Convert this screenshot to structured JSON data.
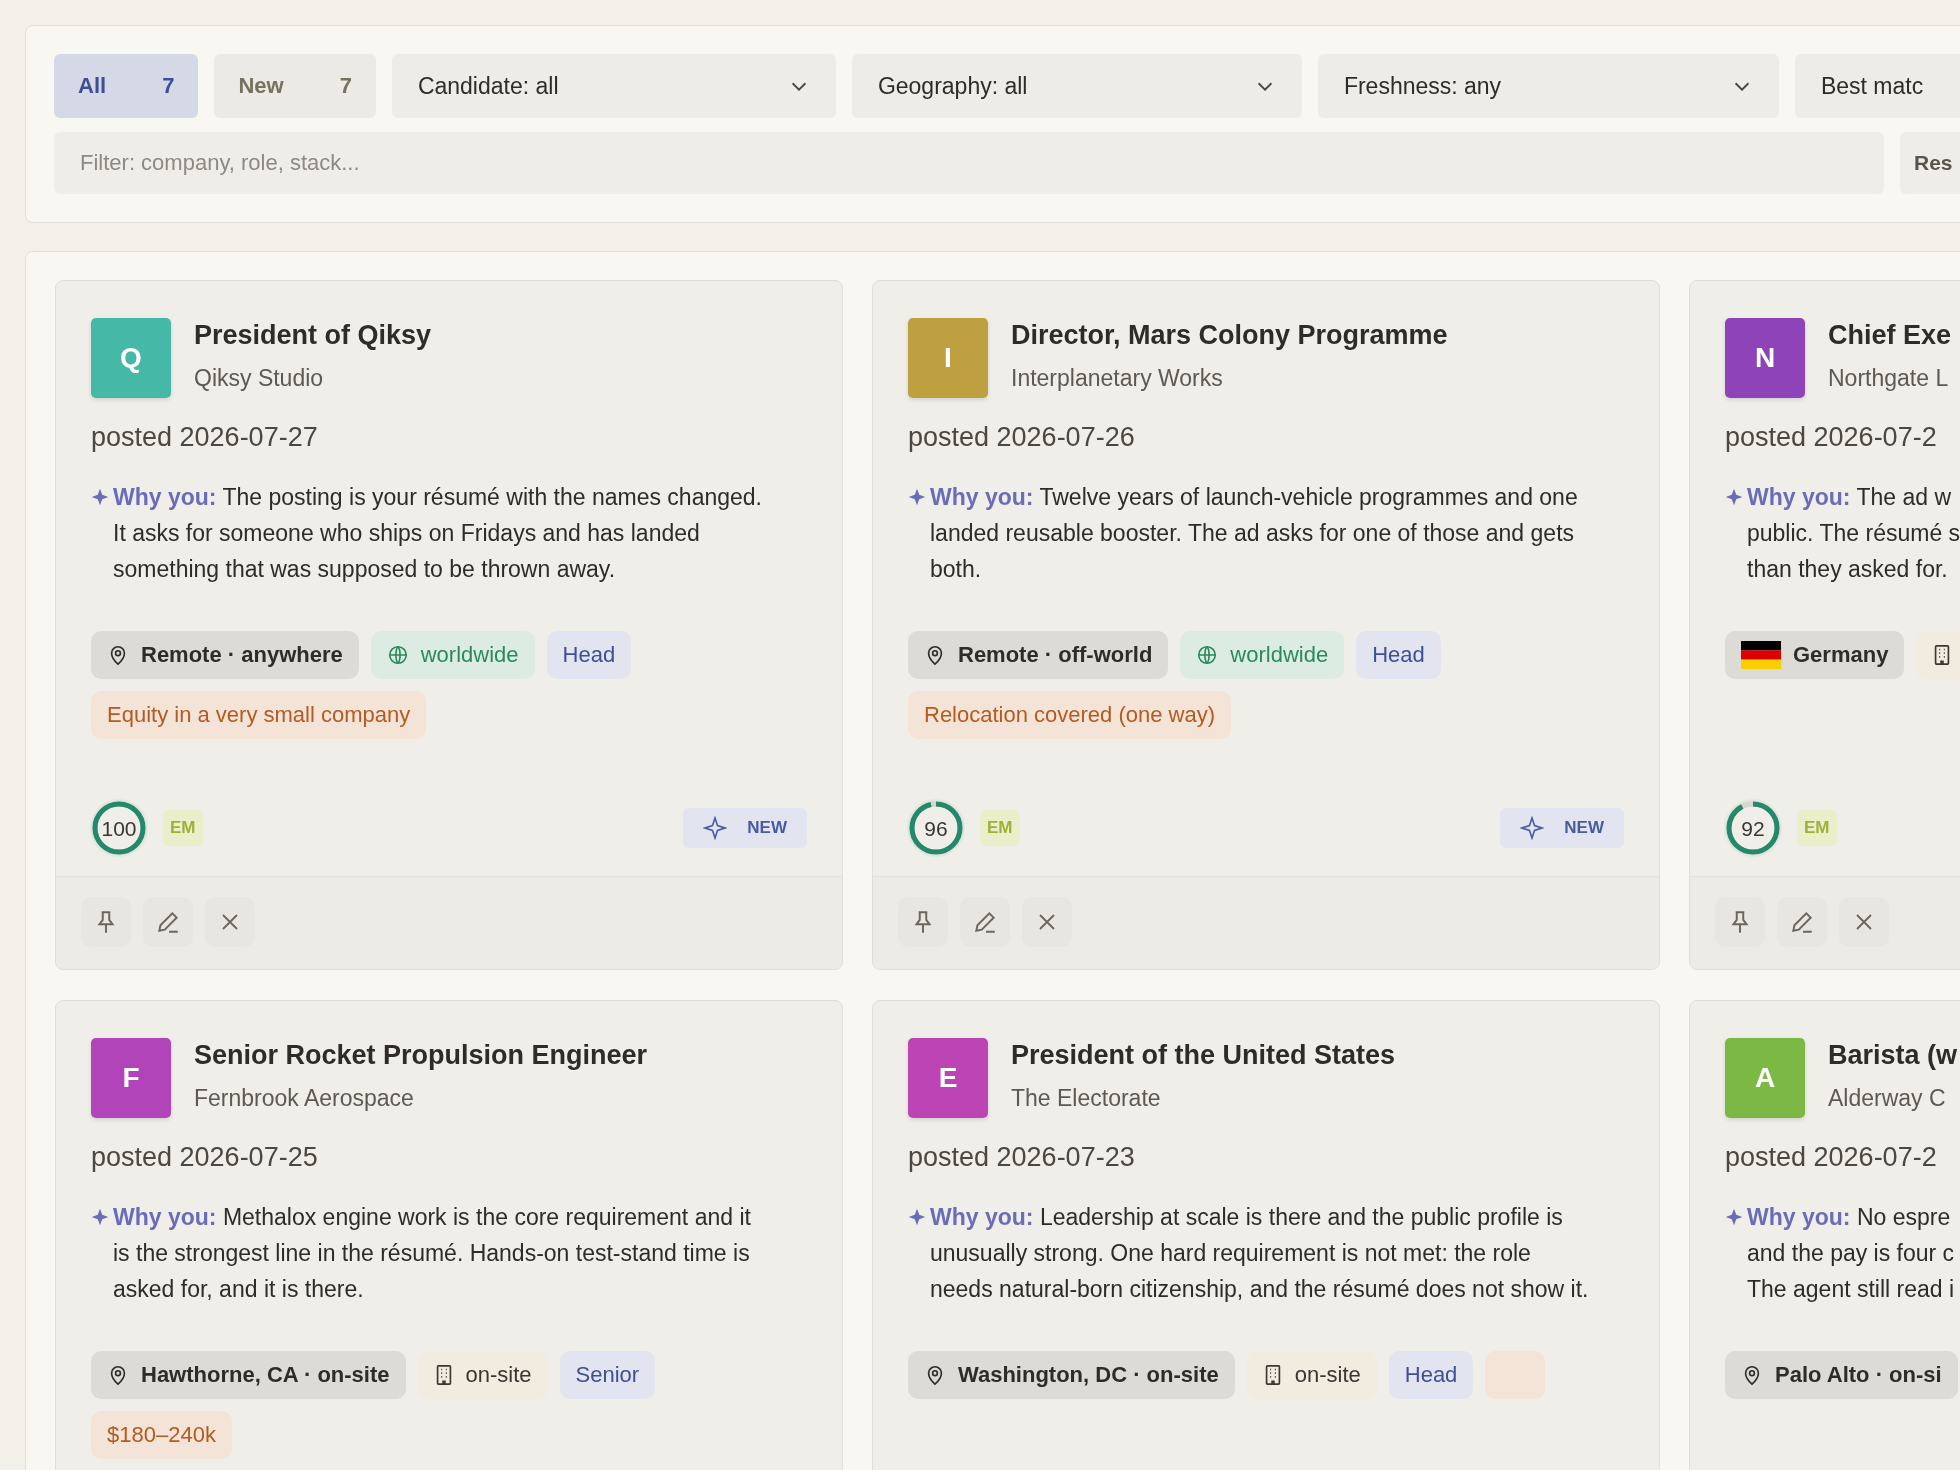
{
  "filters": {
    "tabs": [
      {
        "label": "All",
        "count": "7",
        "selected": true
      },
      {
        "label": "New",
        "count": "7",
        "selected": false
      }
    ],
    "dropdowns": [
      {
        "label": "Candidate: all"
      },
      {
        "label": "Geography: all"
      },
      {
        "label": "Freshness: any"
      },
      {
        "label": "Best matc"
      }
    ],
    "search": {
      "placeholder": "Filter: company, role, stack..."
    },
    "button": "Res"
  },
  "cards": [
    {
      "letter": "Q",
      "color": "#45b8a8",
      "title": "President of Qiksy",
      "company": "Qiksy Studio",
      "posted": "posted 2026-07-27",
      "why_label": "Why you:",
      "why": "The posting is your résumé with the names changed. It asks for someone who ships on Fridays and has landed something that was supposed to be thrown away.",
      "tags": [
        {
          "kind": "location",
          "label": "Remote · anywhere"
        },
        {
          "kind": "remote",
          "label": "worldwide"
        },
        {
          "kind": "level",
          "label": "Head"
        },
        {
          "kind": "perk",
          "label": "Equity in a very small company"
        }
      ],
      "score": "100",
      "level": 1,
      "badge": "EM",
      "new": true,
      "new_label": "NEW"
    },
    {
      "letter": "I",
      "color": "#bfa040",
      "title": "Director, Mars Colony Programme",
      "company": "Interplanetary Works",
      "posted": "posted 2026-07-26",
      "why_label": "Why you:",
      "why": "Twelve years of launch-vehicle programmes and one landed reusable booster. The ad asks for one of those and gets both.",
      "tags": [
        {
          "kind": "location",
          "label": "Remote · off-world"
        },
        {
          "kind": "remote",
          "label": "worldwide"
        },
        {
          "kind": "level",
          "label": "Head"
        },
        {
          "kind": "perk",
          "label": "Relocation covered (one way)"
        }
      ],
      "score": "96",
      "level": 0.96,
      "badge": "EM",
      "new": true,
      "new_label": "NEW"
    },
    {
      "letter": "N",
      "color": "#8e44b8",
      "title": "Chief Exe",
      "company": "Northgate L",
      "posted": "posted 2026-07-2",
      "why_label": "Why you:",
      "why": "The ad w\npublic. The résumé s\nthan they asked for.",
      "tags": [
        {
          "kind": "country",
          "label": "Germany"
        },
        {
          "kind": "onsite"
        }
      ],
      "score": "92",
      "level": 0.92,
      "badge": "EM"
    },
    {
      "letter": "F",
      "color": "#b044b8",
      "title": "Senior Rocket Propulsion Engineer",
      "company": "Fernbrook Aerospace",
      "posted": "posted 2026-07-25",
      "why_label": "Why you:",
      "why": "Methalox engine work is the core requirement and it is the strongest line in the résumé. Hands-on test-stand time is asked for, and it is there.",
      "tags": [
        {
          "kind": "location",
          "label": "Hawthorne, CA · on-site"
        },
        {
          "kind": "onsite",
          "label": "on-site"
        },
        {
          "kind": "level",
          "label": "Senior"
        },
        {
          "kind": "perk",
          "label": "$180–240k"
        }
      ]
    },
    {
      "letter": "E",
      "color": "#bc44b4",
      "title": "President of the United States",
      "company": "The Electorate",
      "posted": "posted 2026-07-23",
      "why_label": "Why you:",
      "why": "Leadership at scale is there and the public profile is unusually strong. One hard requirement is not met: the role needs natural-born citizenship, and the résumé does not show it.",
      "tags": [
        {
          "kind": "location",
          "label": "Washington, DC · on-site"
        },
        {
          "kind": "onsite",
          "label": "on-site"
        },
        {
          "kind": "level",
          "label": "Head"
        },
        {
          "kind": "perk"
        }
      ]
    },
    {
      "letter": "A",
      "color": "#7cb944",
      "title": "Barista (w",
      "company": "Alderway C",
      "posted": "posted 2026-07-2",
      "why_label": "Why you:",
      "why": "No espre\nand the pay is four c\nThe agent still read i",
      "tags": [
        {
          "kind": "location",
          "label": "Palo Alto · on-si"
        }
      ]
    }
  ]
}
